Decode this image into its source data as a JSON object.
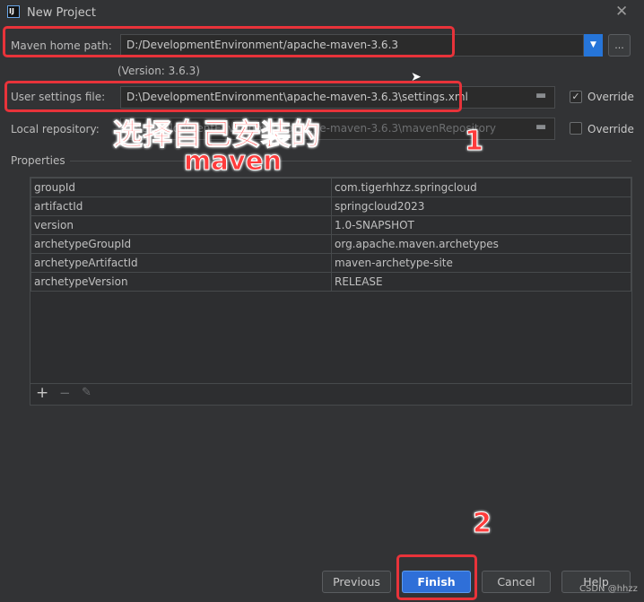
{
  "window": {
    "title": "New Project",
    "app_icon": "IJ"
  },
  "maven_home": {
    "label": "Maven home path:",
    "value": "D:/DevelopmentEnvironment/apache-maven-3.6.3",
    "version": "(Version: 3.6.3)",
    "browse_label": "..."
  },
  "user_settings": {
    "label": "User settings file:",
    "value": "D:\\DevelopmentEnvironment\\apache-maven-3.6.3\\settings.xml",
    "override_label": "Override",
    "override_checked": true
  },
  "local_repo": {
    "label": "Local repository:",
    "value": "D:\\DevelopmentEnvironment\\apache-maven-3.6.3\\mavenRepository",
    "override_label": "Override",
    "override_checked": false
  },
  "properties": {
    "label": "Properties",
    "rows": [
      {
        "key": "groupId",
        "value": "com.tigerhhzz.springcloud"
      },
      {
        "key": "artifactId",
        "value": "springcloud2023"
      },
      {
        "key": "version",
        "value": "1.0-SNAPSHOT"
      },
      {
        "key": "archetypeGroupId",
        "value": "org.apache.maven.archetypes"
      },
      {
        "key": "archetypeArtifactId",
        "value": "maven-archetype-site"
      },
      {
        "key": "archetypeVersion",
        "value": "RELEASE"
      }
    ],
    "add": "+",
    "remove": "−",
    "edit": "✎"
  },
  "annotations": {
    "text1": "选择自己安装的",
    "text2": "maven",
    "num1": "1",
    "num2": "2"
  },
  "buttons": {
    "previous": "Previous",
    "finish": "Finish",
    "cancel": "Cancel",
    "help": "Help"
  },
  "watermark": "CSDN @hhzz",
  "colors": {
    "accent": "#2675d9",
    "annotation": "#e8333a"
  }
}
